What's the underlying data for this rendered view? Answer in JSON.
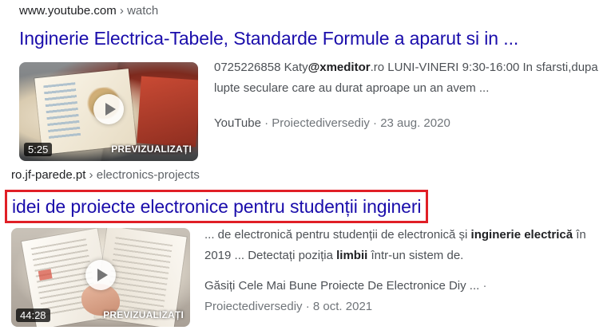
{
  "results": [
    {
      "cite_domain": "www.youtube.com",
      "cite_path": " › watch",
      "title": "Inginerie Electrica-Tabele, Standarde Formule a aparut si in ...",
      "duration": "5:25",
      "preview_label": "PREVIZUALIZAȚI",
      "snippet_1": "0725226858 Katy",
      "snippet_bold_1": "@xmeditor",
      "snippet_2": ".ro LUNI-VINERI 9:30-16:00 In sfarsti,dupa lupte seculare care au durat aproape un an avem ...",
      "source": "YouTube",
      "channel": "Proiectediversediy",
      "date": "23 aug. 2020",
      "separator": " · "
    },
    {
      "cite_domain": "ro.jf-parede.pt",
      "cite_path": " › electronics-projects",
      "title": "idei de proiecte electronice pentru studenții ingineri",
      "duration": "44:28",
      "preview_label": "PREVIZUALIZAȚI",
      "snippet_1": "... de electronică pentru studenții de electronică și ",
      "snippet_bold_1": "inginerie electrică",
      "snippet_2": " în 2019 ... Detectați poziția ",
      "snippet_bold_2": "limbii",
      "snippet_3": " într-un sistem de.",
      "source": "Găsiți Cele Mai Bune Proiecte De Electronice Diy ...",
      "channel": "Proiectediversediy",
      "date": "8 oct. 2021",
      "separator": " · ",
      "separator_end": " ·"
    }
  ],
  "colors": {
    "title_link": "#1a0dab",
    "highlight_box": "#e01f26",
    "snippet_text": "#4d5156",
    "meta_text": "#70757a"
  },
  "icons": {
    "play": "play-icon"
  }
}
